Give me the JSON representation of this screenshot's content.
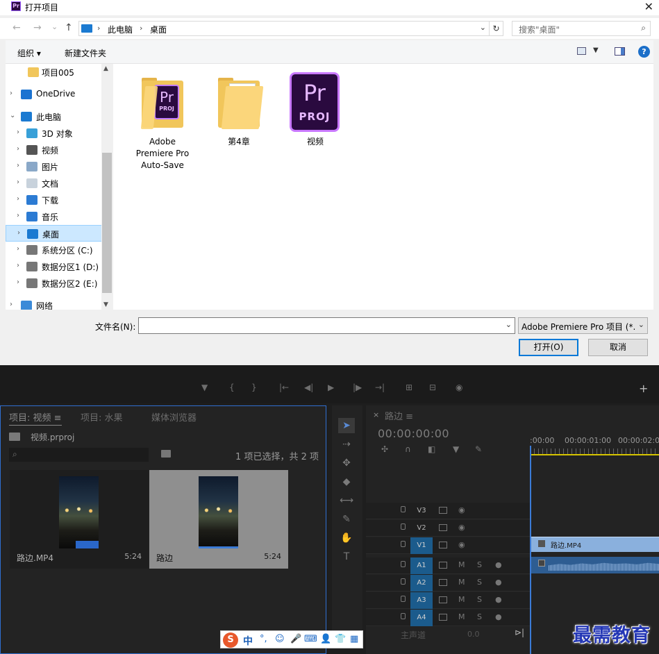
{
  "dialog": {
    "title": "打开项目",
    "close_glyph": "✕",
    "app_icon_text": "Pr",
    "nav": {
      "back": "←",
      "forward": "→",
      "recent": "⌄",
      "up": "↑"
    },
    "breadcrumb": [
      "此电脑",
      "桌面"
    ],
    "breadcrumb_sep": "›",
    "search_placeholder": "搜索\"桌面\"",
    "toolbar": {
      "organize": "组织 ▾",
      "new_folder": "新建文件夹",
      "help": "?"
    },
    "nav_tree": [
      {
        "label": "项目005",
        "icon": "folder-icon",
        "arrow": ""
      },
      {
        "label": "OneDrive",
        "icon": "cloud-icon",
        "arrow": "›"
      },
      {
        "label": "此电脑",
        "icon": "computer-icon",
        "arrow": "⌄"
      },
      {
        "label": "3D 对象",
        "icon": "cube-icon",
        "arrow": "›"
      },
      {
        "label": "视频",
        "icon": "film-icon",
        "arrow": "›"
      },
      {
        "label": "图片",
        "icon": "picture-icon",
        "arrow": "›"
      },
      {
        "label": "文档",
        "icon": "document-icon",
        "arrow": "›"
      },
      {
        "label": "下载",
        "icon": "download-icon",
        "arrow": "›"
      },
      {
        "label": "音乐",
        "icon": "music-icon",
        "arrow": "›"
      },
      {
        "label": "桌面",
        "icon": "desktop-icon",
        "arrow": "›",
        "selected": true
      },
      {
        "label": "系统分区 (C:)",
        "icon": "drive-icon",
        "arrow": "›"
      },
      {
        "label": "数据分区1 (D:)",
        "icon": "drive-icon",
        "arrow": "›"
      },
      {
        "label": "数据分区2 (E:)",
        "icon": "drive-icon",
        "arrow": "›"
      },
      {
        "label": "网络",
        "icon": "network-icon",
        "arrow": "›"
      }
    ],
    "files": [
      {
        "label_lines": [
          "Adobe",
          "Premiere Pro",
          "Auto-Save"
        ],
        "icon": "folder-premiere-icon"
      },
      {
        "label_lines": [
          "第4章"
        ],
        "icon": "folder-icon"
      },
      {
        "label_lines": [
          "视频"
        ],
        "icon": "premiere-project-icon"
      }
    ],
    "pr_icon": {
      "big": "Pr",
      "small": "PROJ"
    },
    "filename_label": "文件名(N):",
    "filename_value": "",
    "filetype": "Adobe Premiere Pro 项目 (*.",
    "open_button": "打开(O)",
    "cancel_button": "取消"
  },
  "premiere": {
    "project_tabs": [
      "项目: 视频  ≡",
      "项目: 水果",
      "媒体浏览器"
    ],
    "project_file": "视频.prproj",
    "search_glyph": "⌕",
    "selection_count": "1 项已选择，共 2 项",
    "clips": [
      {
        "name": "路边.MP4",
        "duration": "5:24"
      },
      {
        "name": "路边",
        "duration": "5:24"
      }
    ],
    "timeline": {
      "close": "×",
      "title": "路边  ≡",
      "timecode": "00:00:00:00",
      "ruler_labels": [
        ":00:00",
        "00:00:01:00",
        "00:00:02:00"
      ],
      "tracks": [
        {
          "name": "V3",
          "on": false,
          "type": "video"
        },
        {
          "name": "V2",
          "on": false,
          "type": "video"
        },
        {
          "name": "V1",
          "on": true,
          "type": "video"
        },
        {
          "name": "A1",
          "on": true,
          "type": "audio"
        },
        {
          "name": "A2",
          "on": true,
          "type": "audio"
        },
        {
          "name": "A3",
          "on": true,
          "type": "audio"
        },
        {
          "name": "A4",
          "on": true,
          "type": "audio"
        }
      ],
      "video_clip_name": "路边.MP4",
      "master_label": "主声道",
      "master_value": "0.0"
    },
    "tool_glyphs": [
      "➤",
      "⇢",
      "✥",
      "◆",
      "⟷",
      "✎",
      "✋",
      "T"
    ],
    "ctrl_glyphs": [
      "▼",
      "{",
      "}",
      "|←",
      "◀|",
      "▶",
      "|▶",
      "→|",
      "⊞",
      "⊟",
      "◉"
    ],
    "plus": "+"
  },
  "ime": {
    "logo": "S",
    "mode": "中",
    "icons": [
      "°,",
      "☺",
      "🎤",
      "⌨",
      "👤",
      "👕",
      "▦"
    ]
  },
  "watermark": "最需教育"
}
